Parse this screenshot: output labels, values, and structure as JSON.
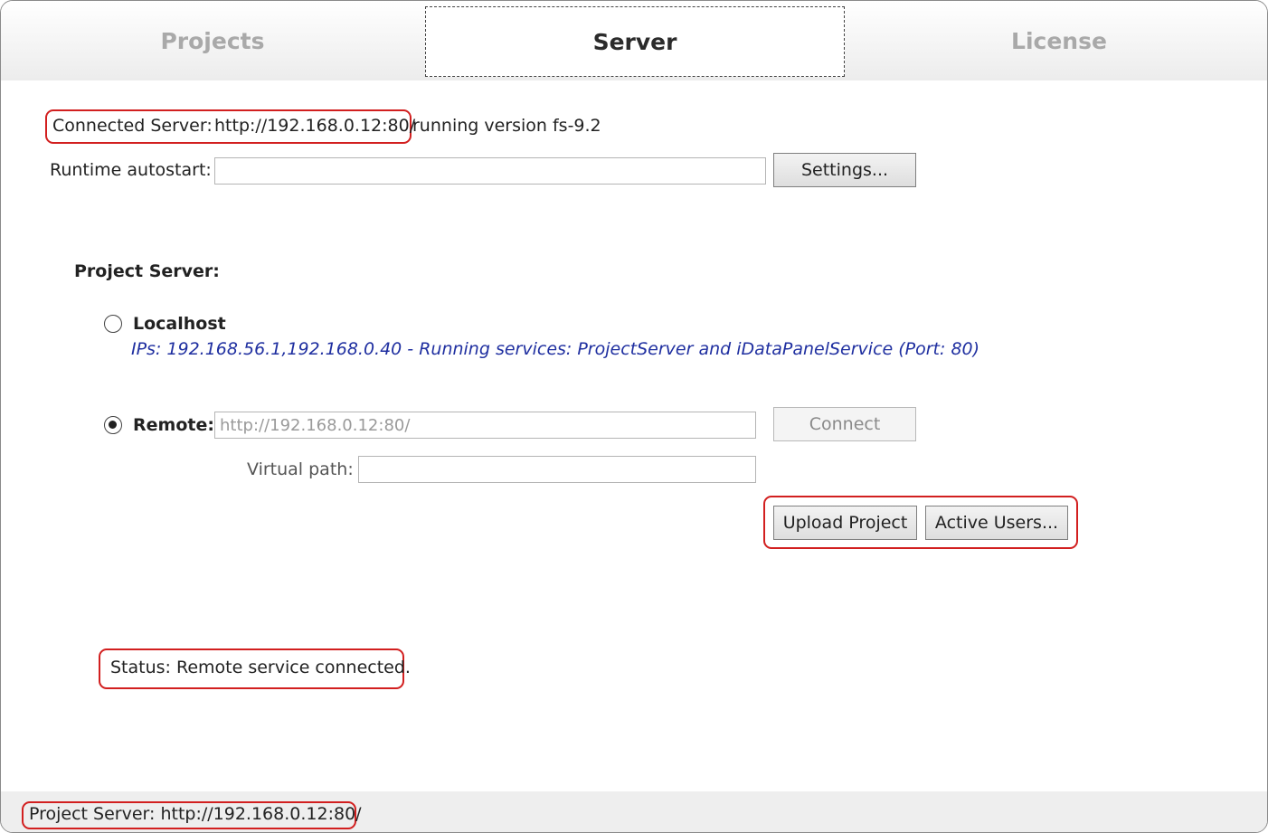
{
  "tabs": [
    {
      "label": "Projects"
    },
    {
      "label": "Server"
    },
    {
      "label": "License"
    }
  ],
  "connected": {
    "label": "Connected Server:",
    "url": "http://192.168.0.12:80/",
    "suffix": "running version fs-9.2"
  },
  "runtime": {
    "label": "Runtime autostart:",
    "value": "",
    "settings_button": "Settings..."
  },
  "project_server": {
    "heading": "Project Server:",
    "localhost": {
      "label": "Localhost",
      "selected": false,
      "info": "IPs: 192.168.56.1,192.168.0.40 - Running services: ProjectServer and iDataPanelService (Port: 80)"
    },
    "remote": {
      "label": "Remote:",
      "selected": true,
      "url_value": "http://192.168.0.12:80/",
      "connect_button": "Connect",
      "virtual_path_label": "Virtual path:",
      "virtual_path_value": ""
    },
    "upload_button": "Upload Project",
    "active_users_button": "Active Users..."
  },
  "status": {
    "text": "Status: Remote service connected."
  },
  "statusbar": {
    "text": "Project Server: http://192.168.0.12:80/"
  },
  "colors": {
    "highlight": "#d21f1f",
    "info_text": "#1f2fa0"
  }
}
